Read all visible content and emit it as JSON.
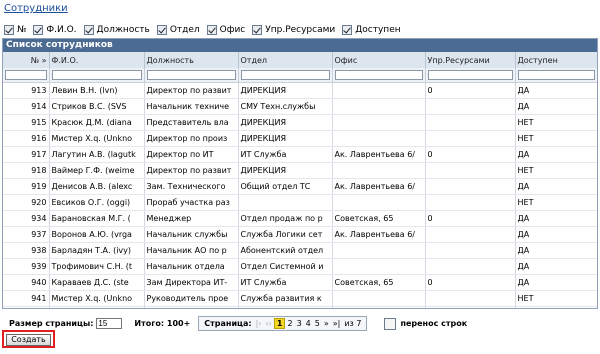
{
  "title": "Сотрудники",
  "filters": [
    {
      "label": "№",
      "checked": true
    },
    {
      "label": "Ф.И.О.",
      "checked": true
    },
    {
      "label": "Должность",
      "checked": true
    },
    {
      "label": "Отдел",
      "checked": true
    },
    {
      "label": "Офис",
      "checked": true
    },
    {
      "label": "Упр.Ресурсами",
      "checked": true
    },
    {
      "label": "Доступен",
      "checked": true
    }
  ],
  "list_title": "Список сотрудников",
  "columns": [
    "№ »",
    "Ф.И.О.",
    "Должность",
    "Отдел",
    "Офис",
    "Упр.Ресурсами",
    "Доступен"
  ],
  "rows": [
    [
      "913",
      "Левин В.Н. (lvn)",
      "Директор по развит",
      "ДИРЕКЦИЯ",
      "",
      "0",
      "ДА"
    ],
    [
      "914",
      "Стриков В.С. (SVS",
      "Начальник техниче",
      "СМУ Техн.службы",
      "",
      "",
      "ДА"
    ],
    [
      "915",
      "Красюк Д.М. (diana",
      "Представитель вла",
      "ДИРЕКЦИЯ",
      "",
      "",
      "НЕТ"
    ],
    [
      "916",
      "Мистер Х.q. (Unkno",
      "Директор по произ",
      "ДИРЕКЦИЯ",
      "",
      "",
      "НЕТ"
    ],
    [
      "917",
      "Лагутин А.В. (lagutk",
      "Директор по ИТ",
      "ИТ Служба",
      "Ак. Лаврентьева 6/",
      "0",
      "ДА"
    ],
    [
      "918",
      "Ваймер Г.Ф. (weime",
      "Директор по развит",
      "ДИРЕКЦИЯ",
      "",
      "",
      "НЕТ"
    ],
    [
      "919",
      "Денисов А.В. (alexc",
      "Зам. Технического",
      "Общий отдел ТС",
      "Ак. Лаврентьева 6/",
      "",
      "ДА"
    ],
    [
      "920",
      "Евсиков О.Г. (oggi)",
      "Прораб участка раз",
      "",
      "",
      "",
      "НЕТ"
    ],
    [
      "934",
      "Барановская М.Г. (",
      "Менеджер",
      "Отдел продаж по р",
      "Советская, 65",
      "0",
      "ДА"
    ],
    [
      "937",
      "Воронов А.Ю. (vrga",
      "Начальник службы",
      "Служба Логики сет",
      "Ак. Лаврентьева 6/",
      "",
      "ДА"
    ],
    [
      "938",
      "Барладян Т.А. (ivy)",
      "Начальник АО по р",
      "Абонентский отдел",
      "",
      "",
      "ДА"
    ],
    [
      "939",
      "Трофимович С.Н. (t",
      "Начальник отдела",
      "Отдел Системной и",
      "",
      "",
      "ДА"
    ],
    [
      "940",
      "Караваев Д.С. (ste",
      "Зам Директора ИТ-",
      "ИТ Служба",
      "Советская, 65",
      "0",
      "ДА"
    ],
    [
      "941",
      "Мистер Х.q. (Unkno",
      "Руководитель прое",
      "Служба развития к",
      "",
      "",
      "НЕТ"
    ],
    [
      "942",
      "Левшаков М.Н. (Lev",
      "Начальник отдела",
      "Отдел согласовани",
      "",
      "",
      "НЕТ"
    ]
  ],
  "footer": {
    "page_size_label": "Размер страницы:",
    "page_size_value": "15",
    "total_label": "Итого: 100+",
    "pager_label": "Страница:",
    "nav_first": "|‹",
    "nav_prev": "‹‹",
    "pages": [
      "1",
      "2",
      "3",
      "4",
      "5"
    ],
    "current_page": "1",
    "nav_next": "»",
    "nav_last": "»|",
    "of_label": "из 7",
    "wrap_label": "перенос строк"
  },
  "create_button": "Создать",
  "colors": {
    "header_bg": "#4b6b93",
    "highlight": "#e02020",
    "current_page": "#f4d61e"
  }
}
